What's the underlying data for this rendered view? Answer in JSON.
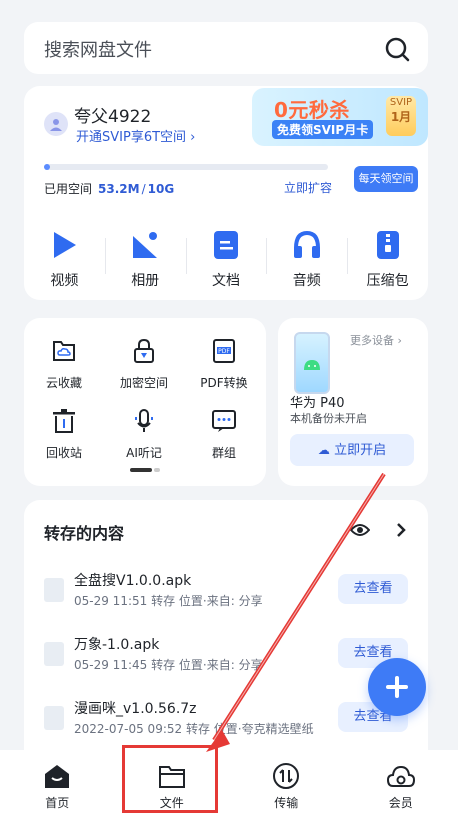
{
  "search": {
    "placeholder": "搜索网盘文件"
  },
  "account": {
    "username": "夸父4922",
    "svip_link": "开通SVIP享6T空间 ›",
    "promo": {
      "headline": "0元秒杀",
      "sub": "免费领SVIP月卡",
      "badge_top": "SVIP",
      "badge_bottom": "1月"
    },
    "storage": {
      "label": "已用空间",
      "used": "53.2M",
      "separator": "/",
      "total": "10G",
      "fraction_used": 0.005
    },
    "expand": "立即扩容",
    "daily_button": "每天领空间"
  },
  "categories": [
    {
      "label": "视频",
      "icon": "video-icon"
    },
    {
      "label": "相册",
      "icon": "album-icon"
    },
    {
      "label": "文档",
      "icon": "document-icon"
    },
    {
      "label": "音频",
      "icon": "audio-icon"
    },
    {
      "label": "压缩包",
      "icon": "archive-icon"
    }
  ],
  "tools": [
    {
      "label": "云收藏",
      "icon": "cloud-favorite-icon"
    },
    {
      "label": "加密空间",
      "icon": "lock-icon"
    },
    {
      "label": "PDF转换",
      "icon": "pdf-icon"
    },
    {
      "label": "回收站",
      "icon": "trash-icon"
    },
    {
      "label": "AI听记",
      "icon": "microphone-icon"
    },
    {
      "label": "群组",
      "icon": "group-icon"
    }
  ],
  "device": {
    "more": "更多设备 ›",
    "name": "华为 P40",
    "status": "本机备份未开启",
    "enable": "立即开启"
  },
  "saved": {
    "title": "转存的内容",
    "items": [
      {
        "name": "全盘搜V1.0.0.apk",
        "meta": "05-29 11:51 转存 位置·来自:  分享",
        "action": "去查看"
      },
      {
        "name": "万象-1.0.apk",
        "meta": "05-29 11:45 转存 位置·来自:  分享",
        "action": "去查看"
      },
      {
        "name": "漫画咪_v1.0.56.7z",
        "meta": "2022-07-05 09:52 转存 位置·夸克精选壁纸",
        "action": "去查看"
      }
    ]
  },
  "tabs": [
    {
      "label": "首页",
      "icon": "home-icon"
    },
    {
      "label": "文件",
      "icon": "folder-icon"
    },
    {
      "label": "传输",
      "icon": "transfer-icon"
    },
    {
      "label": "会员",
      "icon": "member-icon"
    }
  ],
  "colors": {
    "accent": "#3e7bf6",
    "annotation": "#e53935"
  }
}
